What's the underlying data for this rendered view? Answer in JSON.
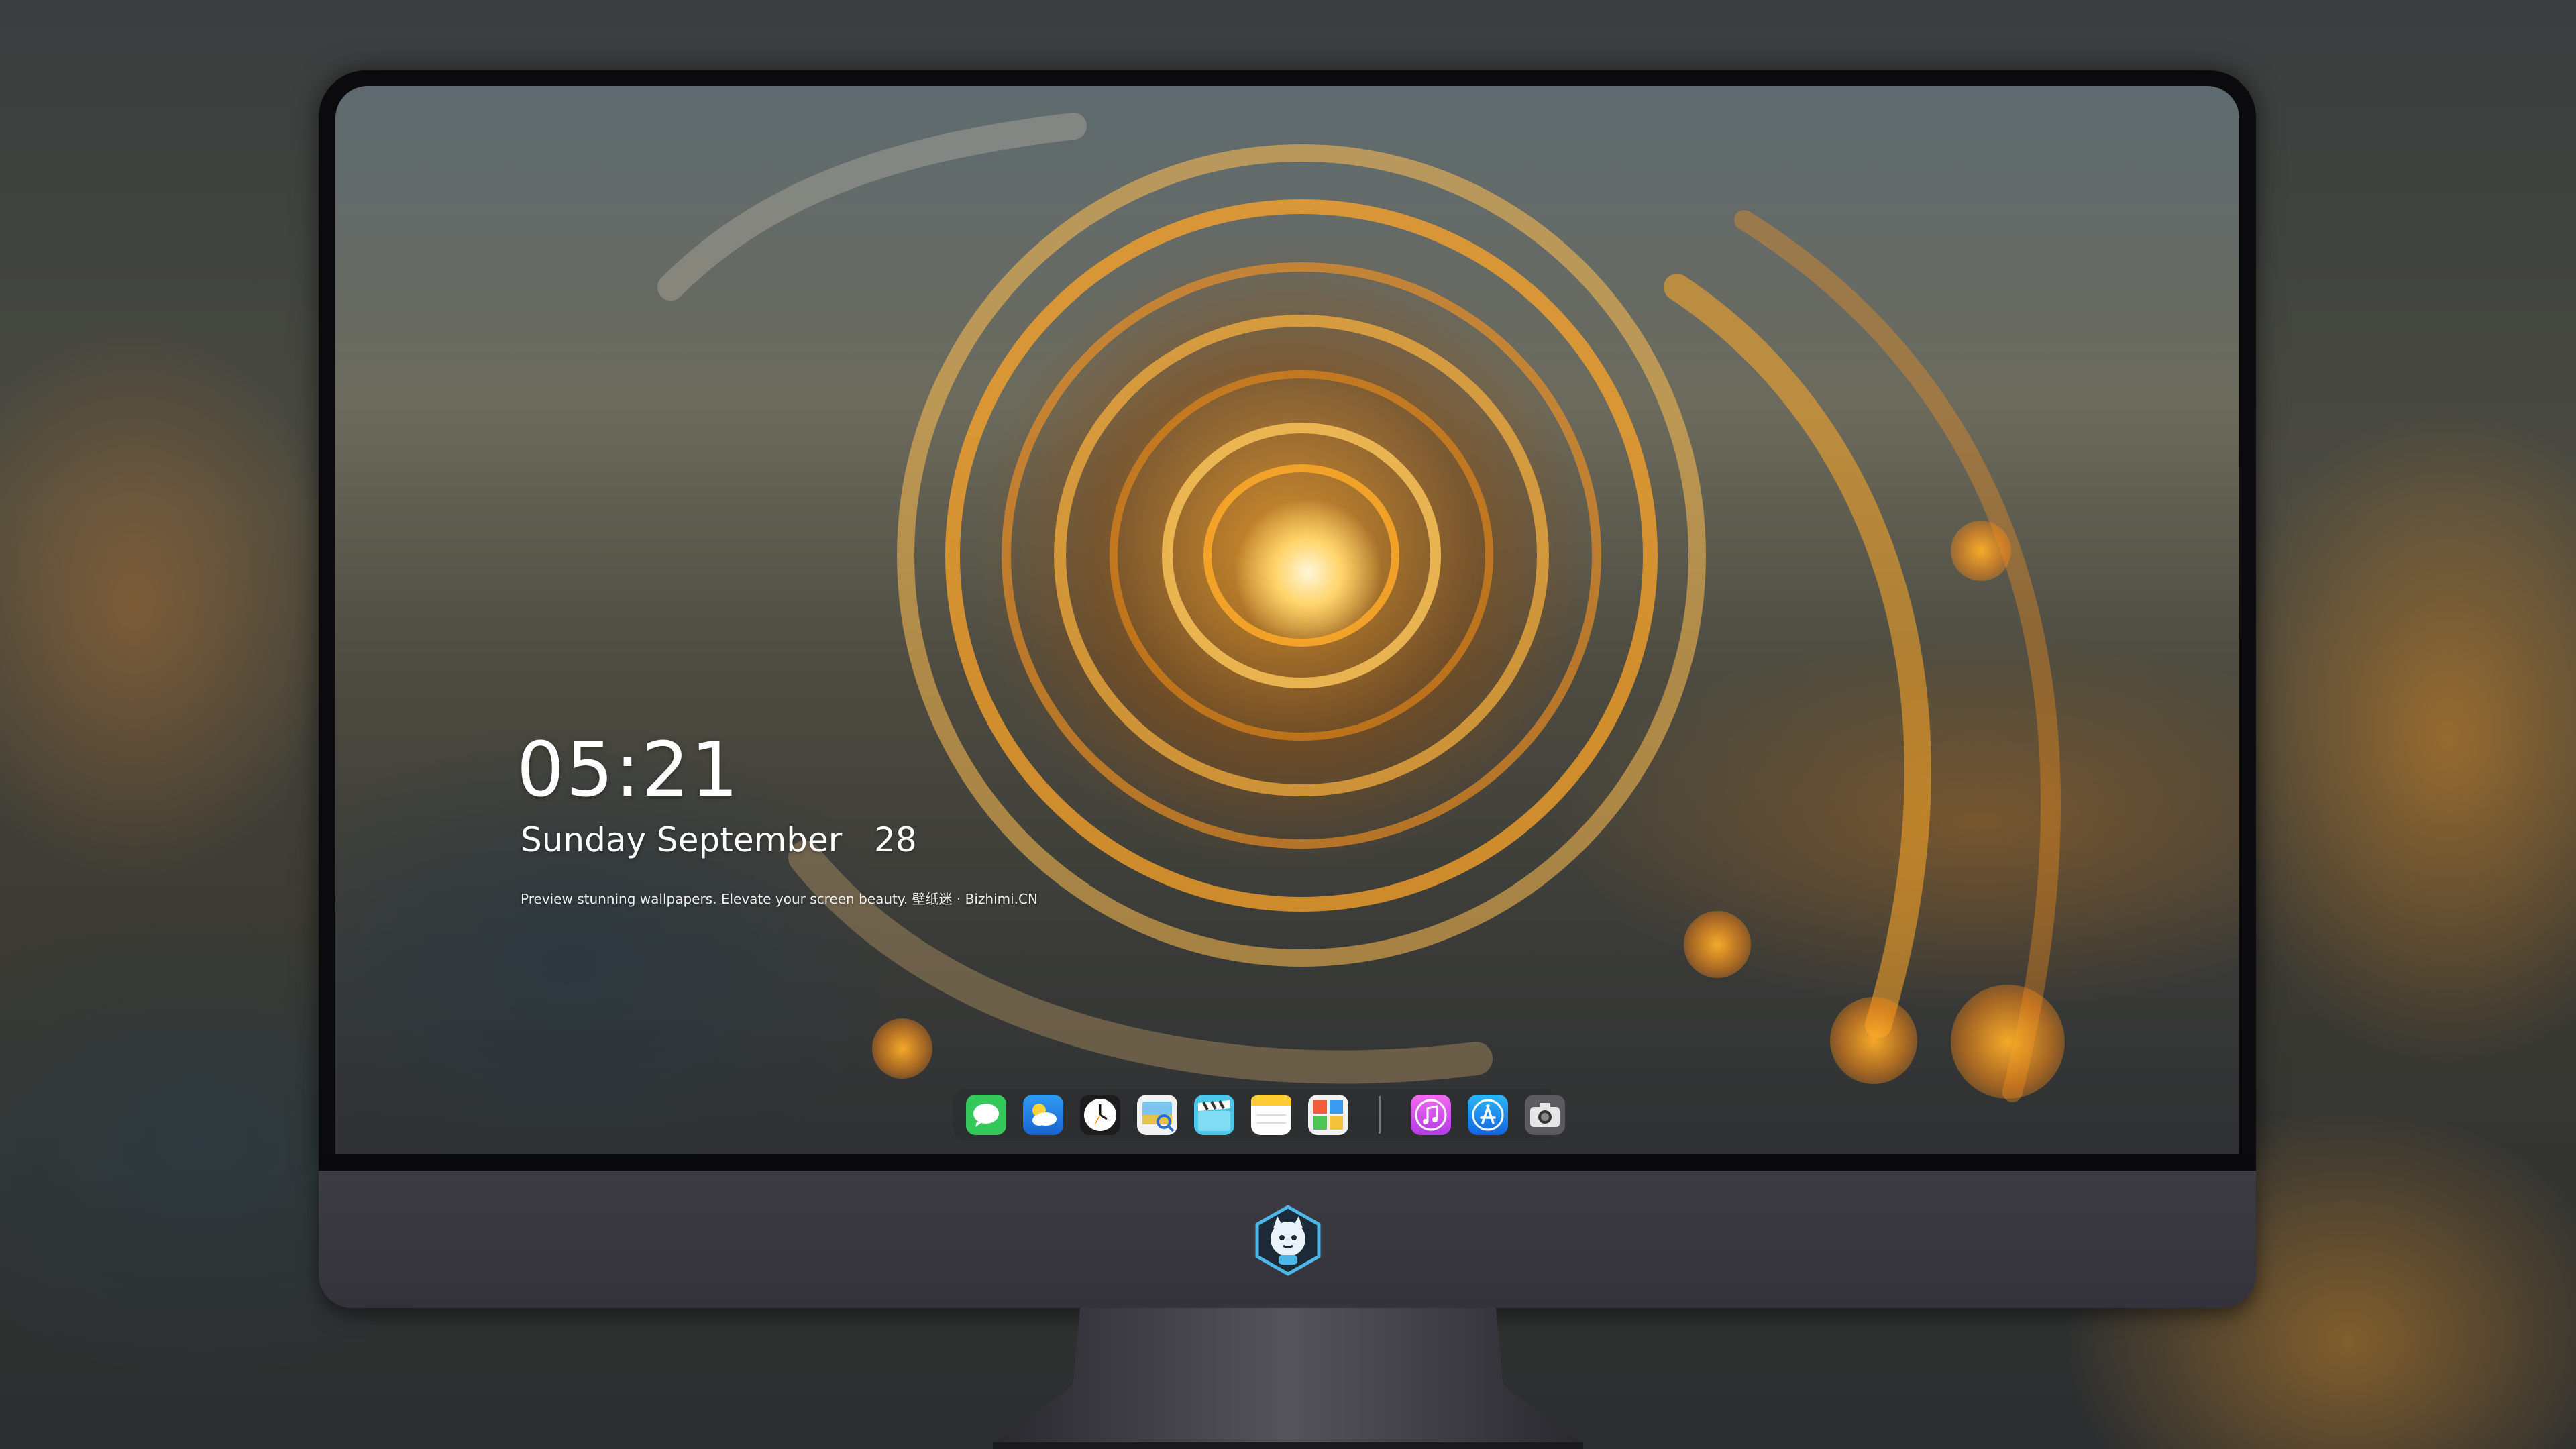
{
  "lock_screen": {
    "time": "05:21",
    "date": "Sunday September   28",
    "caption": "Preview stunning wallpapers. Elevate your screen beauty. 壁纸迷 · Bizhimi.CN"
  },
  "dock": {
    "apps": [
      {
        "name": "messages-icon",
        "color": "#34c759"
      },
      {
        "name": "weather-icon",
        "color": "#2f8ff0"
      },
      {
        "name": "clock-icon",
        "color": "#1c1c1e"
      },
      {
        "name": "preview-icon",
        "color": "#f4f4f4"
      },
      {
        "name": "claquette-icon",
        "color": "#49c6e8"
      },
      {
        "name": "notes-icon",
        "color": "#ffcc33"
      },
      {
        "name": "photo-booth-icon",
        "color": "#f2f2f2"
      }
    ],
    "pinned": [
      {
        "name": "itunes-icon",
        "color": "#d94cf0"
      },
      {
        "name": "app-store-icon",
        "color": "#1e8ff5"
      },
      {
        "name": "camera-icon",
        "color": "#5c5c60"
      }
    ]
  },
  "hardware": {
    "logo": "bizhimi-mascot-logo",
    "bezel_color": "#0b0b0d",
    "chin_color": "#38363e"
  }
}
